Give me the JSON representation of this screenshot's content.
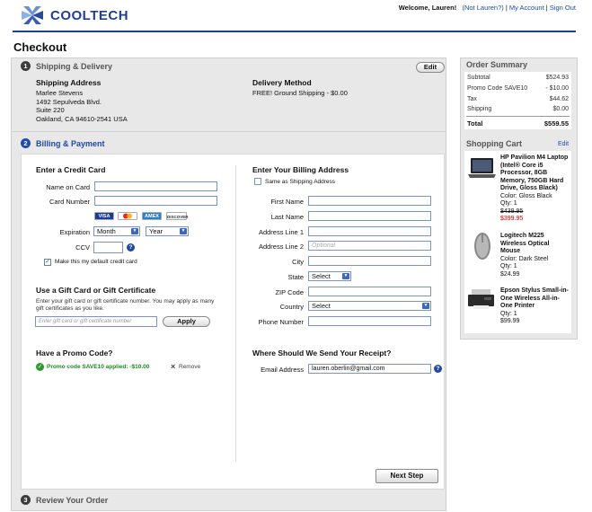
{
  "brand": {
    "name": "COOLTECH"
  },
  "topbar": {
    "welcome": "Welcome, Lauren!",
    "not_user": "(Not Lauren?)",
    "sep1": "|",
    "account": "My Account",
    "sep2": "|",
    "signout": "Sign Out"
  },
  "page": {
    "title": "Checkout"
  },
  "step1": {
    "num": "1",
    "title": "Shipping & Delivery",
    "edit": "Edit",
    "address_heading": "Shipping Address",
    "address_lines": [
      "Marlee Stevens",
      "1492 Sepulveda Blvd.",
      "Suite 220",
      "Oakland, CA 94610-2541 USA"
    ],
    "method_heading": "Delivery Method",
    "method_value": "FREE! Ground Shipping - $0.00"
  },
  "step2": {
    "num": "2",
    "title": "Billing & Payment",
    "credit": {
      "heading": "Enter a Credit Card",
      "name_label": "Name on Card",
      "number_label": "Card Number",
      "cards": [
        "VISA",
        "MC",
        "AMEX",
        "DISCOVER"
      ],
      "exp_label": "Expiration",
      "month": "Month",
      "year": "Year",
      "ccv_label": "CCV",
      "help": "?",
      "default_label": "Make this my default credit card"
    },
    "gift": {
      "heading": "Use a Gift Card or Gift Certificate",
      "desc": "Enter your gift card or gift certificate number. You may apply as many gift certificates as you like.",
      "placeholder": "Enter gift card or gift certificate number",
      "apply": "Apply"
    },
    "promo": {
      "heading": "Have a Promo Code?",
      "applied": "Promo code SAVE10 applied: -$10.00",
      "remove": "Remove"
    },
    "billing": {
      "heading": "Enter Your Billing Address",
      "same_label": "Same as Shipping Address",
      "fields": [
        "First Name",
        "Last Name",
        "Address Line 1",
        "Address Line 2",
        "City",
        "State",
        "ZIP Code",
        "Country",
        "Phone Number"
      ],
      "optional": "Optional",
      "state_value": "Select",
      "country_value": "Select"
    },
    "receipt": {
      "heading": "Where Should We Send Your Receipt?",
      "email_label": "Email Address",
      "email_value": "lauren.oberlin@gmail.com"
    },
    "next": "Next Step"
  },
  "step3": {
    "num": "3",
    "title": "Review Your Order"
  },
  "summary": {
    "title": "Order Summary",
    "rows": [
      {
        "label": "Subtotal",
        "value": "$524.93"
      },
      {
        "label": "Promo Code SAVE10",
        "value": "- $10.00"
      },
      {
        "label": "Tax",
        "value": "$44.62"
      },
      {
        "label": "Shipping",
        "value": "$0.00"
      }
    ],
    "total_label": "Total",
    "total_value": "$559.55"
  },
  "cart": {
    "title": "Shopping Cart",
    "edit": "Edit",
    "items": [
      {
        "name": "HP Pavilion M4 Laptop (Intel® Core i5 Processor, 8GB Memory, 750GB Hard Drive, Gloss Black)",
        "color": "Color: Gloss Black",
        "qty": "Qty: 1",
        "old_price": "$439.95",
        "price": "$399.95"
      },
      {
        "name": "Logitech M225 Wireless Optical Mouse",
        "color": "Color: Dark Steel",
        "qty": "Qty: 1",
        "price": "$24.99"
      },
      {
        "name": "Epson Stylus Small-in-One Wireless All-in-One Printer",
        "qty": "Qty: 1",
        "price": "$99.99"
      }
    ]
  }
}
